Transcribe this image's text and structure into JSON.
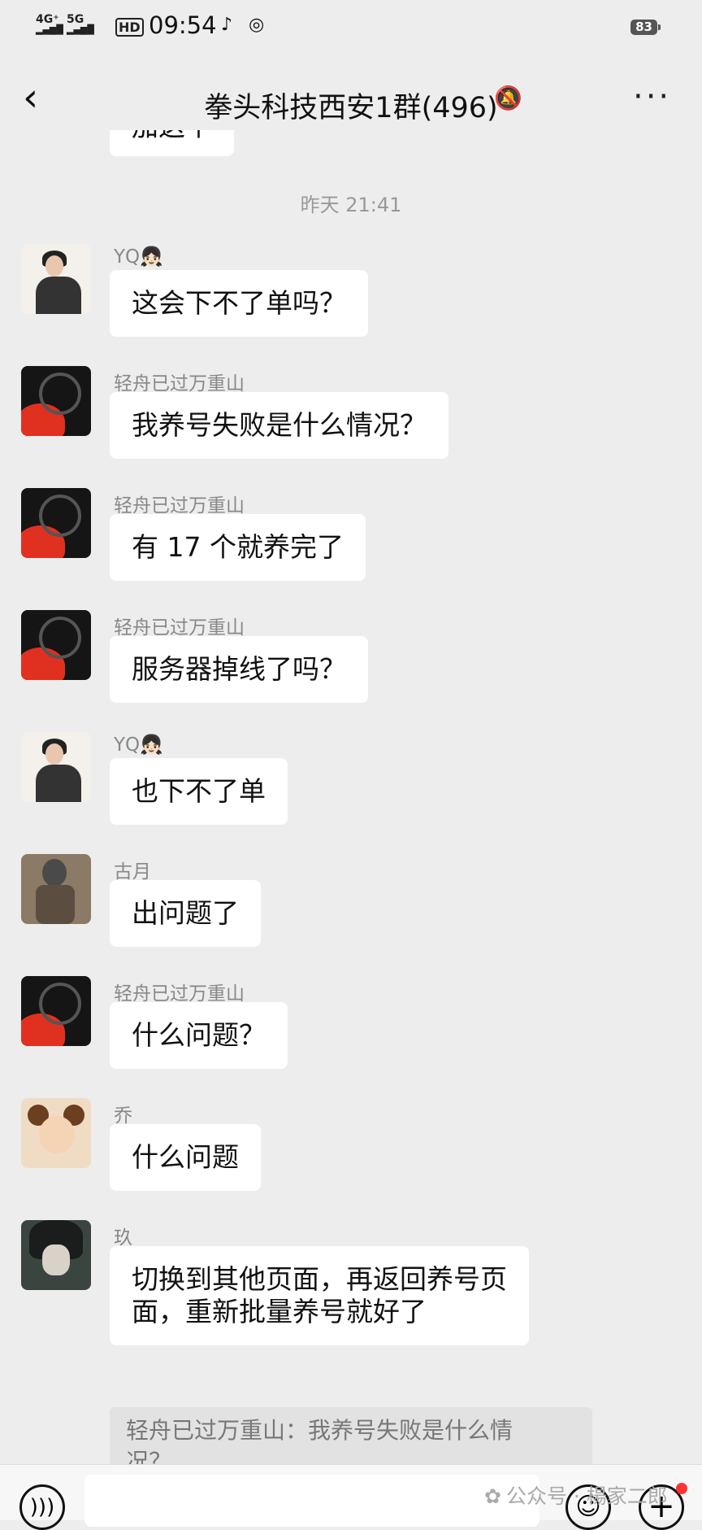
{
  "status_bar": {
    "network1": "4G⁺",
    "network2": "5G",
    "hd": "HD",
    "time": "09:54",
    "battery": "83"
  },
  "header": {
    "title": "拳头科技西安1群(496)",
    "back_icon": "chevron-left-icon",
    "mute_icon": "bell-off-icon",
    "more_icon": "more-dots-icon"
  },
  "top_partial_bubble": "加这个",
  "time_separator": "昨天  21:41",
  "messages": [
    {
      "sender": "YQ👧🏻",
      "text": "这会下不了单吗？"
    },
    {
      "sender": "轻舟已过万重山",
      "text": "我养号失败是什么情况？"
    },
    {
      "sender": "轻舟已过万重山",
      "text": "有 17 个就养完了"
    },
    {
      "sender": "轻舟已过万重山",
      "text": "服务器掉线了吗？"
    },
    {
      "sender": "YQ👧🏻",
      "text": "也下不了单"
    },
    {
      "sender": "古月",
      "text": "出问题了"
    },
    {
      "sender": "轻舟已过万重山",
      "text": "什么问题？"
    },
    {
      "sender": "乔",
      "text": "什么问题"
    },
    {
      "sender": "玖",
      "text_line1": "切换到其他页面，再返回养号页",
      "text_line2": "面，重新批量养号就好了"
    }
  ],
  "quote": {
    "line1": "轻舟已过万重山：我养号失败是什么情",
    "line2": "况？"
  },
  "watermark": "公众号 · 楊家二郎",
  "bottom_bar": {
    "voice_icon": "voice-icon",
    "emoji_icon": "emoji-icon",
    "plus_icon": "plus-icon"
  }
}
